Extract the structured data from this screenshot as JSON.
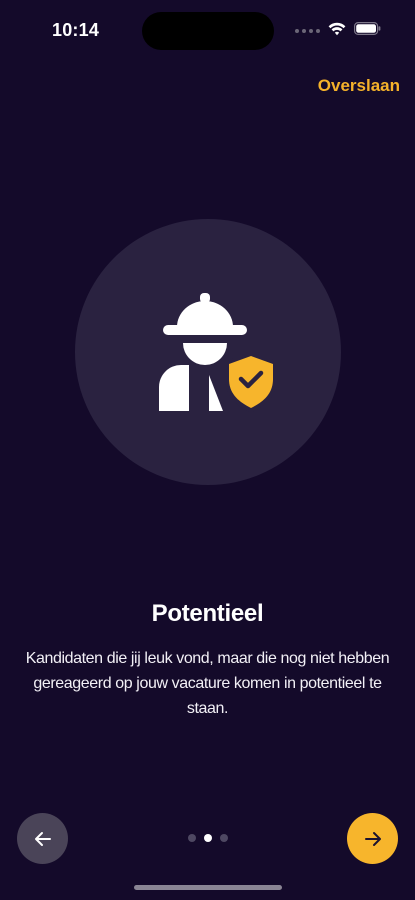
{
  "status_bar": {
    "time": "10:14"
  },
  "header": {
    "skip_label": "Overslaan"
  },
  "slide": {
    "title": "Potentieel",
    "description": "Kandidaten die jij leuk vond, maar die nog niet hebben gereageerd op jouw vacature komen in potentieel te staan.",
    "illustration_icon": "worker-with-shield-check-icon"
  },
  "pagination": {
    "total_pages": 3,
    "current_page": 2
  },
  "navigation": {
    "back_icon": "arrow-left-icon",
    "next_icon": "arrow-right-icon"
  },
  "colors": {
    "background": "#140a2a",
    "accent": "#f7b52c",
    "circle": "#2a2240"
  }
}
